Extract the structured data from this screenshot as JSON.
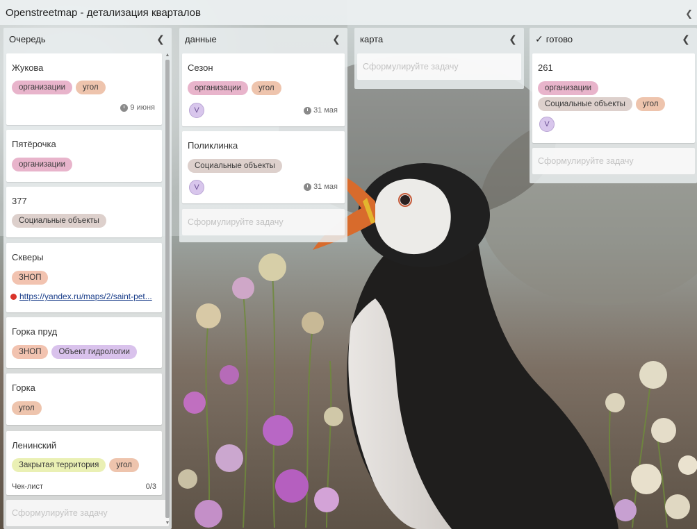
{
  "board": {
    "title": "Openstreetmap - детализация кварталов",
    "collapse_icon": "chevron-left-icon"
  },
  "columns": [
    {
      "title": "Очередь",
      "cards": [
        {
          "title": "Жукова",
          "tags": [
            "организации",
            "угол"
          ],
          "due": "9 июня"
        },
        {
          "title": "Пятёрочка",
          "tags": [
            "организации"
          ]
        },
        {
          "title": "377",
          "tags": [
            "Социальные объекты"
          ]
        },
        {
          "title": "Скверы",
          "tags": [
            "ЗНОП"
          ],
          "link": "https://yandex.ru/maps/2/saint-pet..."
        },
        {
          "title": "Горка пруд",
          "tags": [
            "ЗНОП",
            "Объект гидрологии"
          ]
        },
        {
          "title": "Горка",
          "tags": [
            "угол"
          ]
        },
        {
          "title": "Ленинский",
          "tags": [
            "Закрытая территория",
            "угол"
          ],
          "checklist_label": "Чек-лист",
          "checklist_progress": "0/3"
        }
      ],
      "add_placeholder": "Сформулируйте задачу"
    },
    {
      "title": "данные",
      "cards": [
        {
          "title": "Сезон",
          "tags": [
            "организации",
            "угол"
          ],
          "avatar": "V",
          "due": "31 мая"
        },
        {
          "title": "Поликлинка",
          "tags": [
            "Социальные объекты"
          ],
          "avatar": "V",
          "due": "31 мая"
        }
      ],
      "add_placeholder": "Сформулируйте задачу"
    },
    {
      "title": "карта",
      "cards": [],
      "add_placeholder": "Сформулируйте задачу"
    },
    {
      "title": "готово",
      "check_icon": "check-icon",
      "cards": [
        {
          "title": "261",
          "tags": [
            "организации",
            "Социальные объекты",
            "угол"
          ],
          "avatar": "V"
        }
      ],
      "add_placeholder": "Сформулируйте задачу"
    }
  ],
  "tag_colors": {
    "организации": "#e8b4cb",
    "угол": "#eec4ad",
    "Социальные объекты": "#ddd0cc",
    "ЗНОП": "#f2c3b0",
    "Объект гидрологии": "#d9c2ec",
    "Закрытая территория": "#eaf0b4"
  }
}
